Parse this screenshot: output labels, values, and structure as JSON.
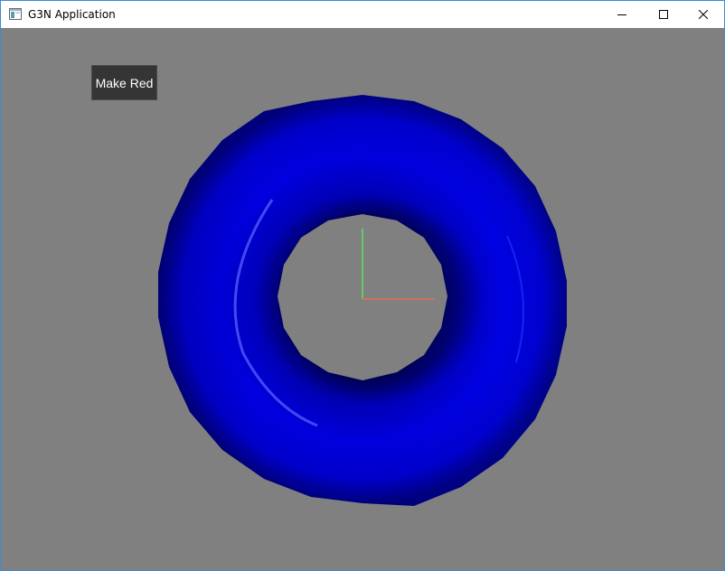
{
  "window": {
    "title": "G3N Application",
    "controls": {
      "minimize_icon": "minimize-icon",
      "maximize_icon": "maximize-icon",
      "close_icon": "close-icon"
    }
  },
  "viewport": {
    "background_color": "#808080"
  },
  "gui": {
    "button_label": "Make Red"
  },
  "scene": {
    "torus_color": "#0000ff",
    "axes": {
      "x_color": "#e07050",
      "y_color": "#60e060"
    }
  }
}
